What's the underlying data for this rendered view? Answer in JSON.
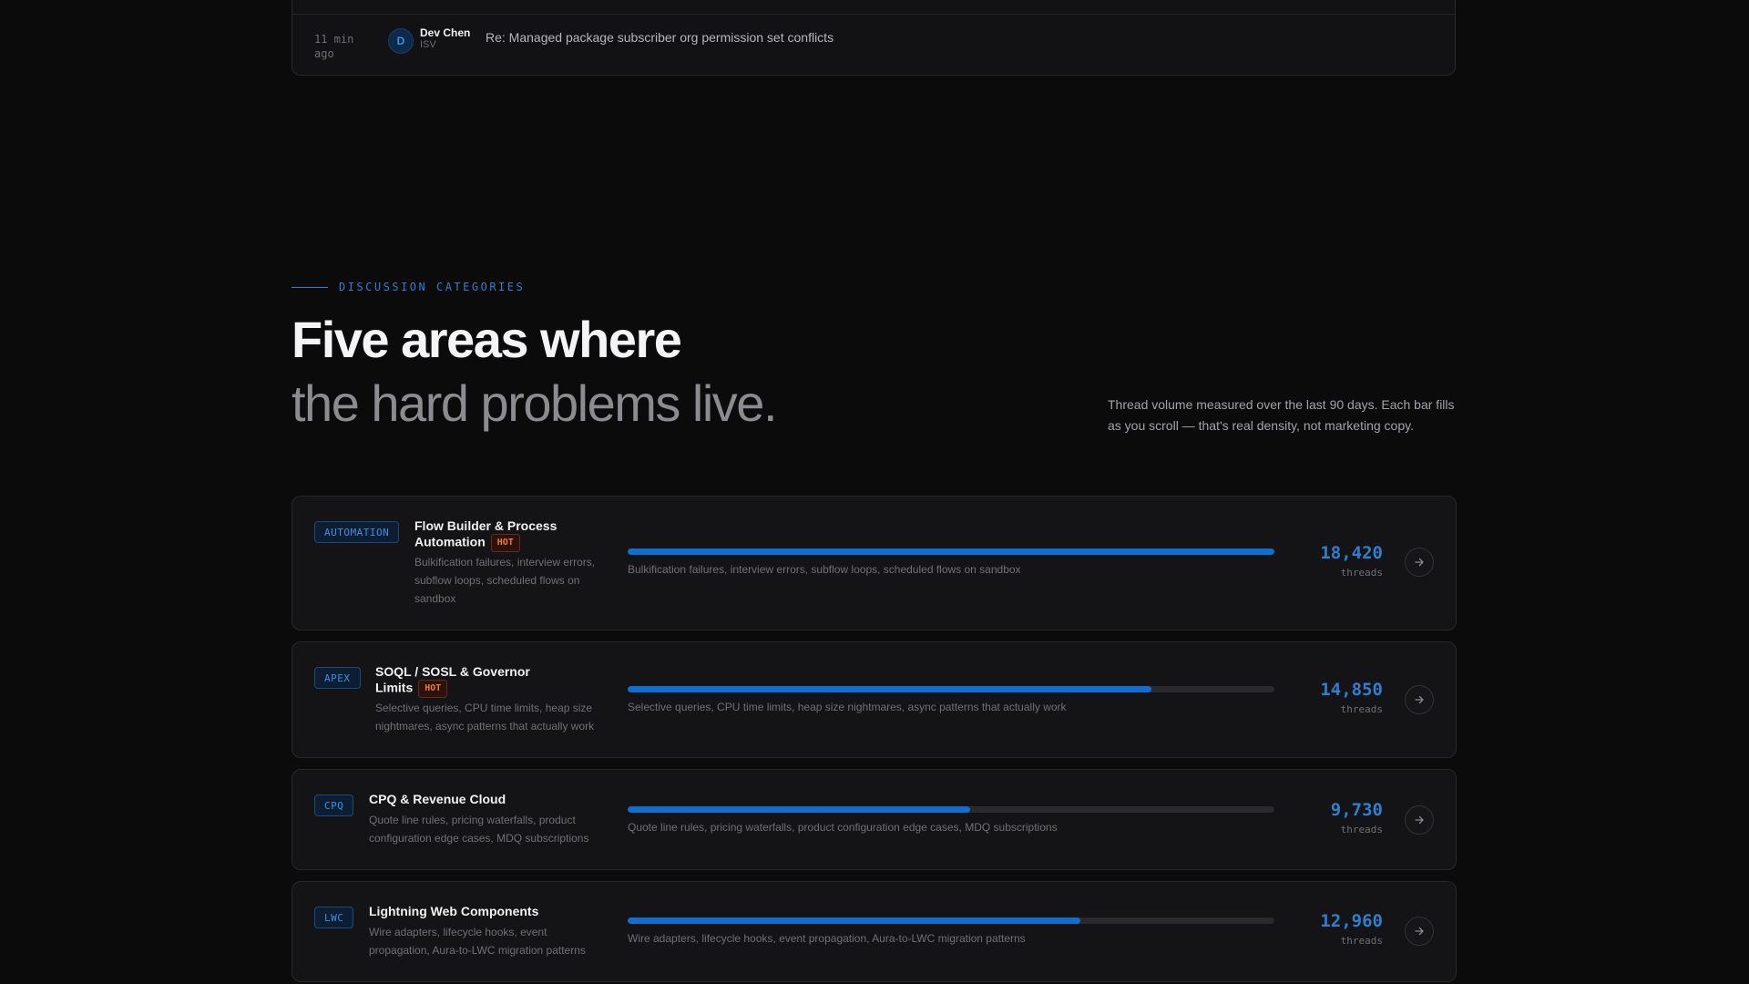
{
  "recent_activity": {
    "time": "11 min ago",
    "author_initial": "D",
    "author_name": "Dev Chen",
    "author_role": "ISV",
    "subject": "Re: Managed package subscriber org permission set conflicts"
  },
  "section": {
    "eyebrow": "DISCUSSION CATEGORIES",
    "headline_line1": "Five areas where",
    "headline_line2": "the hard problems live.",
    "note": "Thread volume measured over the last 90 days. Each bar fills as you scroll — that's real density, not marketing copy."
  },
  "colors": {
    "accent": "#2f7fd1",
    "bar_fill": "#0f6fd0",
    "hot": "#f0773f"
  },
  "categories": [
    {
      "tag": "AUTOMATION",
      "title": "Flow Builder & Process Automation",
      "hot": true,
      "hot_label": "HOT",
      "description": "Bulkification failures, interview errors, subflow loops, scheduled flows on sandbox",
      "bar_caption": "Bulkification failures, interview errors, subflow loops, scheduled flows on sandbox",
      "fill_percent": 100,
      "count": "18,420",
      "count_unit": "threads",
      "arrow_icon": "arrow-right-icon"
    },
    {
      "tag": "APEX",
      "title": "SOQL / SOSL & Governor Limits",
      "hot": true,
      "hot_label": "HOT",
      "description": "Selective queries, CPU time limits, heap size nightmares, async patterns that actually work",
      "bar_caption": "Selective queries, CPU time limits, heap size nightmares, async patterns that actually work",
      "fill_percent": 81,
      "count": "14,850",
      "count_unit": "threads",
      "arrow_icon": "arrow-right-icon"
    },
    {
      "tag": "CPQ",
      "title": "CPQ & Revenue Cloud",
      "hot": false,
      "description": "Quote line rules, pricing waterfalls, product configuration edge cases, MDQ subscriptions",
      "bar_caption": "Quote line rules, pricing waterfalls, product configuration edge cases, MDQ subscriptions",
      "fill_percent": 53,
      "count": "9,730",
      "count_unit": "threads",
      "arrow_icon": "arrow-right-icon"
    },
    {
      "tag": "LWC",
      "title": "Lightning Web Components",
      "hot": false,
      "description": "Wire adapters, lifecycle hooks, event propagation, Aura-to-LWC migration patterns",
      "bar_caption": "Wire adapters, lifecycle hooks, event propagation, Aura-to-LWC migration patterns",
      "fill_percent": 70,
      "count": "12,960",
      "count_unit": "threads",
      "arrow_icon": "arrow-right-icon"
    }
  ]
}
